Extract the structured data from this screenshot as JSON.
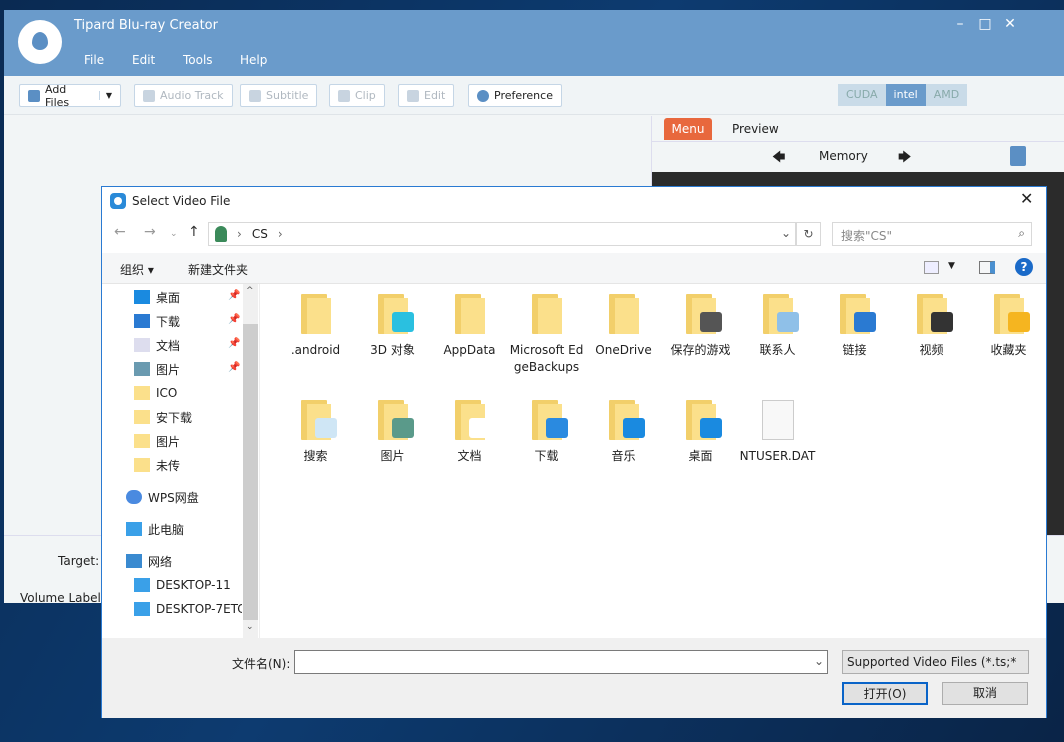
{
  "app": {
    "title": "Tipard Blu-ray Creator",
    "menu": [
      "File",
      "Edit",
      "Tools",
      "Help"
    ],
    "toolbar": {
      "add_files": "Add Files",
      "audio_track": "Audio Track",
      "subtitle": "Subtitle",
      "clip": "Clip",
      "edit": "Edit",
      "preference": "Preference"
    },
    "gpu": {
      "cuda": "CUDA",
      "intel": "intel",
      "amd": "AMD",
      "active": "intel"
    },
    "panel": {
      "tab_menu": "Menu",
      "tab_preview": "Preview",
      "memory": "Memory"
    },
    "bottom": {
      "target_label": "Target:",
      "volume_label": "Volume Label:"
    },
    "colors": {
      "titlebar": "#6a9bcb",
      "menu_tab": "#e8683d"
    }
  },
  "dialog": {
    "title": "Select Video File",
    "address": [
      "CS"
    ],
    "search_placeholder": "搜索\"CS\"",
    "organize": "组织 ▾",
    "new_folder": "新建文件夹",
    "sidebar": [
      {
        "label": "桌面",
        "icon": "desktop-icon",
        "pinned": true
      },
      {
        "label": "下载",
        "icon": "download-icon",
        "pinned": true
      },
      {
        "label": "文档",
        "icon": "document-icon",
        "pinned": true
      },
      {
        "label": "图片",
        "icon": "picture-icon",
        "pinned": true
      },
      {
        "label": "ICO",
        "icon": "folder-icon"
      },
      {
        "label": "安下载",
        "icon": "folder-icon"
      },
      {
        "label": "图片",
        "icon": "folder-icon"
      },
      {
        "label": "未传",
        "icon": "folder-icon"
      },
      {
        "label": "WPS网盘",
        "icon": "cloud-icon"
      },
      {
        "label": "此电脑",
        "icon": "computer-icon"
      },
      {
        "label": "网络",
        "icon": "network-icon"
      },
      {
        "label": "DESKTOP-11",
        "icon": "computer-icon"
      },
      {
        "label": "DESKTOP-7ETC",
        "icon": "computer-icon"
      }
    ],
    "items": [
      {
        "label": ".android",
        "type": "folder"
      },
      {
        "label": "3D 对象",
        "type": "folder",
        "overlay": "#2ac0e0"
      },
      {
        "label": "AppData",
        "type": "folder"
      },
      {
        "label": "Microsoft EdgeBackups",
        "type": "folder"
      },
      {
        "label": "OneDrive",
        "type": "folder"
      },
      {
        "label": "保存的游戏",
        "type": "folder",
        "overlay": "#555555"
      },
      {
        "label": "联系人",
        "type": "folder",
        "overlay": "#8fc0e8"
      },
      {
        "label": "链接",
        "type": "folder",
        "overlay": "#2a7ad2"
      },
      {
        "label": "视频",
        "type": "folder",
        "overlay": "#333333"
      },
      {
        "label": "收藏夹",
        "type": "folder",
        "overlay": "#f5b520"
      },
      {
        "label": "搜索",
        "type": "folder",
        "overlay": "#cfe6f5"
      },
      {
        "label": "图片",
        "type": "folder",
        "overlay": "#5a9a8a"
      },
      {
        "label": "文档",
        "type": "folder",
        "overlay": "#ffffff"
      },
      {
        "label": "下载",
        "type": "folder",
        "overlay": "#2a8ae0"
      },
      {
        "label": "音乐",
        "type": "folder",
        "overlay": "#1a8ae0"
      },
      {
        "label": "桌面",
        "type": "folder",
        "overlay": "#1a8ae0"
      },
      {
        "label": "NTUSER.DAT",
        "type": "file"
      }
    ],
    "filename_label": "文件名(N):",
    "filename_value": "",
    "filetype": "Supported Video Files (*.ts;*",
    "open": "打开(O)",
    "cancel": "取消"
  }
}
